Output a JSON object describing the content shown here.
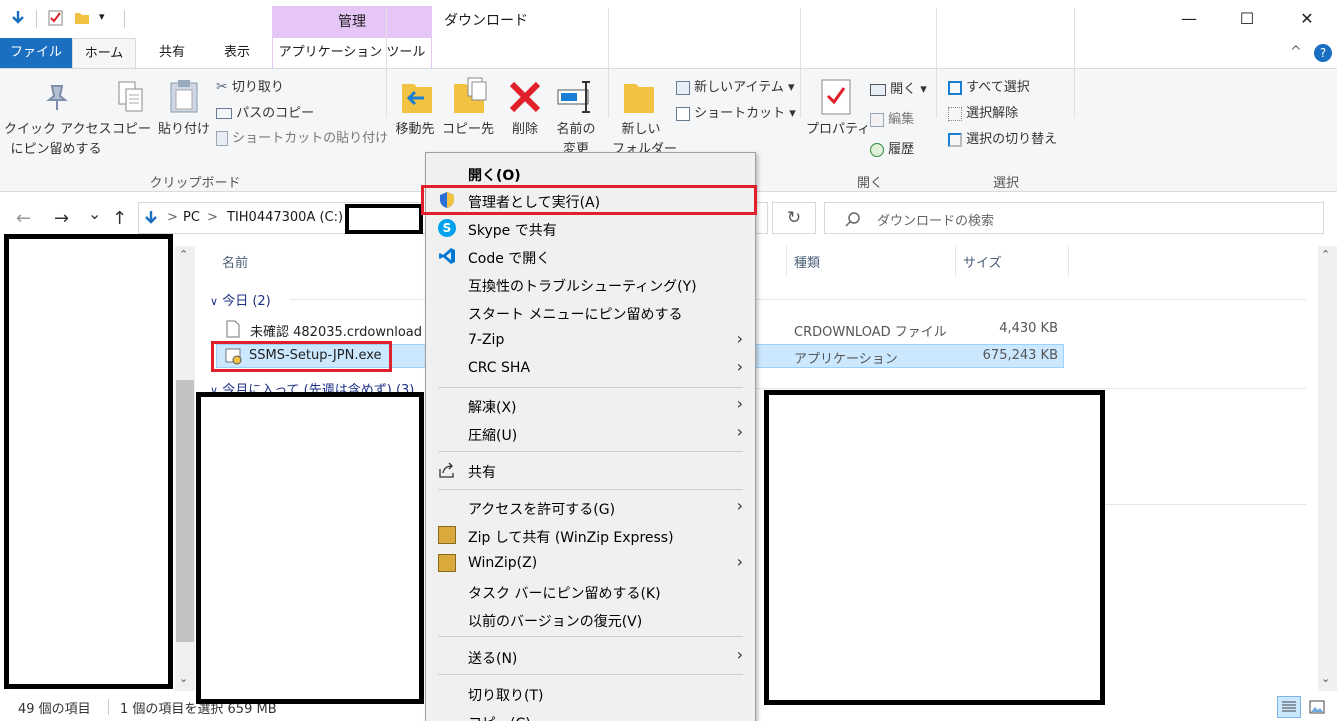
{
  "window": {
    "title": "ダウンロード",
    "manage_tab": "管理",
    "minimize": "—",
    "maximize": "☐",
    "close": "✕"
  },
  "tabs": {
    "file": "ファイル",
    "home": "ホーム",
    "share": "共有",
    "view": "表示",
    "app_tools": "アプリケーション ツール",
    "collapse": "^",
    "help": "?"
  },
  "ribbon": {
    "pin_line1": "クイック アクセス",
    "pin_line2": "にピン留めする",
    "copy": "コピー",
    "paste": "貼り付け",
    "cut": "切り取り",
    "copy_path": "パスのコピー",
    "paste_shortcut": "ショートカットの貼り付け",
    "clipboard_group": "クリップボード",
    "move_to": "移動先",
    "copy_to": "コピー先",
    "delete": "削除",
    "rename_line1": "名前の",
    "rename_line2": "変更",
    "new_folder_line1": "新しい",
    "new_folder_line2": "フォルダー",
    "new_item": "新しいアイテム ▾",
    "shortcut": "ショートカット ▾",
    "properties": "プロパティ",
    "open": "開く ▾",
    "edit": "編集",
    "history": "履歴",
    "open_group": "開く",
    "select_all": "すべて選択",
    "select_none": "選択解除",
    "invert_selection": "選択の切り替え",
    "select_group": "選択"
  },
  "address": {
    "back": "←",
    "forward": "→",
    "recent": "⌄",
    "up": "↑",
    "crumb_pc": "PC",
    "crumb_sep": ">",
    "crumb_drive": "TIH0447300A (C:)",
    "refresh": "↻",
    "search_placeholder": "ダウンロードの検索"
  },
  "filelist": {
    "col_name": "名前",
    "col_type": "種類",
    "col_size": "サイズ",
    "group_today": "今日 (2)",
    "group_month": "今月に入って (先週は含めず) (3)",
    "rows": [
      {
        "name": "未確認 482035.crdownload",
        "type": "CRDOWNLOAD ファイル",
        "size": "4,430 KB"
      },
      {
        "name": "SSMS-Setup-JPN.exe",
        "type": "アプリケーション",
        "size": "675,243 KB"
      }
    ]
  },
  "status": {
    "count": "49 個の項目",
    "selected": "1 個の項目を選択 659 MB"
  },
  "context_menu": {
    "items": [
      {
        "label": "開く(O)",
        "bold": true
      },
      {
        "label": "管理者として実行(A)"
      },
      {
        "label": "Skype で共有"
      },
      {
        "label": "Code で開く"
      },
      {
        "label": "互換性のトラブルシューティング(Y)"
      },
      {
        "label": "スタート メニューにピン留めする"
      },
      {
        "label": "7-Zip"
      },
      {
        "label": "CRC SHA"
      },
      {
        "label": "解凍(X)"
      },
      {
        "label": "圧縮(U)"
      },
      {
        "label": "共有"
      },
      {
        "label": "アクセスを許可する(G)"
      },
      {
        "label": "Zip して共有 (WinZip Express)"
      },
      {
        "label": "WinZip(Z)"
      },
      {
        "label": "タスク バーにピン留めする(K)"
      },
      {
        "label": "以前のバージョンの復元(V)"
      },
      {
        "label": "送る(N)"
      },
      {
        "label": "切り取り(T)"
      },
      {
        "label": "コピー(C)"
      }
    ]
  },
  "colors": {
    "file_tab": "#1a6fc1",
    "manage_tab": "#e6c6f7",
    "selection": "#cce8ff",
    "highlight_border": "#e0202a"
  }
}
